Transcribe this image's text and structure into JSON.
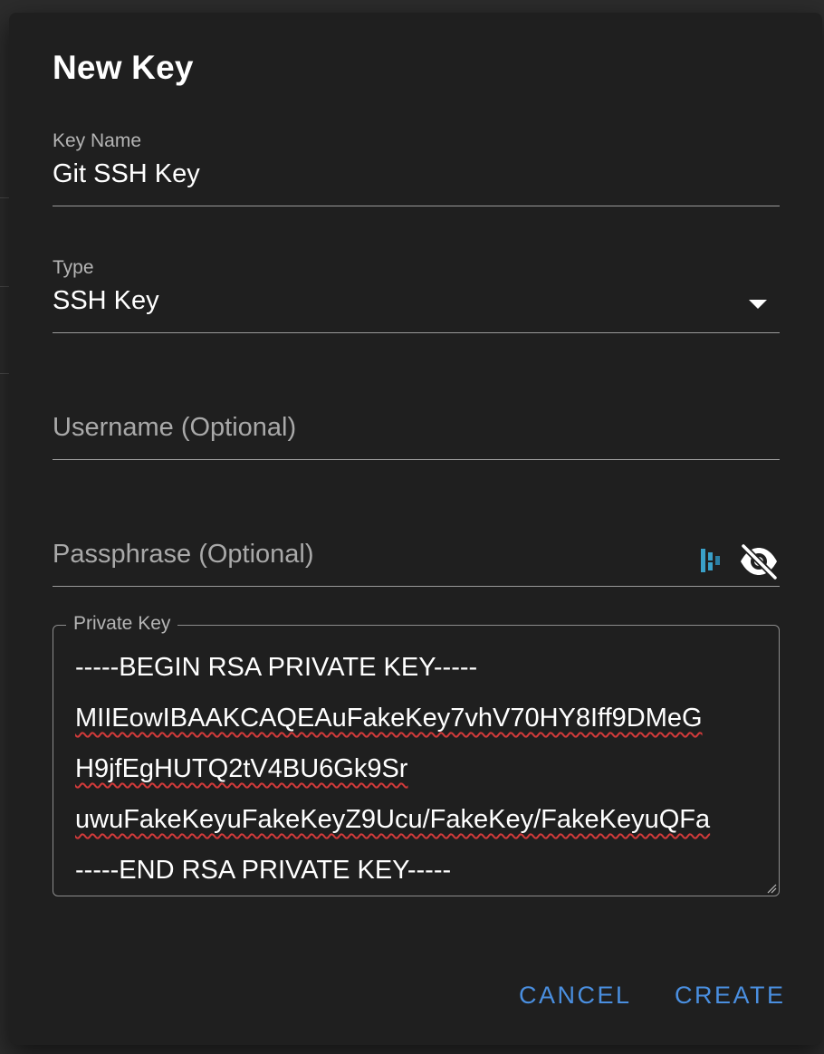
{
  "dialog": {
    "title": "New Key"
  },
  "fields": {
    "key_name": {
      "label": "Key Name",
      "value": "Git SSH Key"
    },
    "type": {
      "label": "Type",
      "value": "SSH Key",
      "dropdown_icon": "chevron-down-icon"
    },
    "username": {
      "placeholder": "Username (Optional)"
    },
    "passphrase": {
      "placeholder": "Passphrase (Optional)",
      "manager_icon": "password-manager-icon",
      "visibility_icon": "eye-off-icon"
    },
    "private_key": {
      "label": "Private Key",
      "lines": [
        "-----BEGIN RSA PRIVATE KEY-----",
        "MIIEowIBAAKCAQEAuFakeKey7vhV70HY8Iff9DMeG",
        "H9jfEgHUTQ2tV4BU6Gk9Sr",
        "uwuFakeKeyuFakeKeyZ9Ucu/FakeKey/FakeKeyuQFa",
        "-----END RSA PRIVATE KEY-----"
      ]
    }
  },
  "actions": {
    "cancel_label": "CANCEL",
    "create_label": "CREATE"
  },
  "colors": {
    "dialog_background": "#1f1f1f",
    "accent": "#4a8fe0",
    "text_primary": "#ffffff",
    "text_secondary": "#b5b5b5",
    "spellcheck_underline": "#d23a3a",
    "password_manager_icon": "#3aa0c8"
  }
}
